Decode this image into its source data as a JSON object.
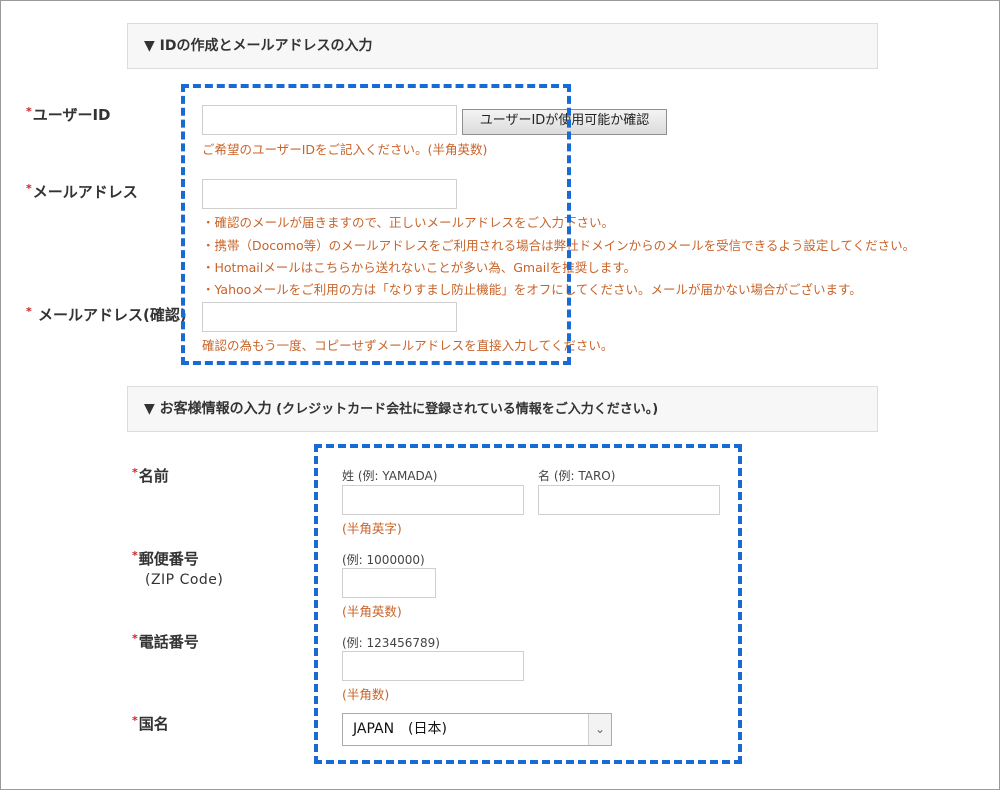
{
  "section1": {
    "title": "▼ IDの作成とメールアドレスの入力"
  },
  "user_id": {
    "required_mark": "*",
    "label": "ユーザーID",
    "check_button": "ユーザーIDが使用可能か確認",
    "hint": "ご希望のユーザーIDをご記入ください。(半角英数)"
  },
  "email": {
    "required_mark": "*",
    "label": "メールアドレス",
    "notes": [
      "・確認のメールが届きますので、正しいメールアドレスをご入力下さい。",
      "・携帯（Docomo等）のメールアドレスをご利用される場合は弊社ドメインからのメールを受信できるよう設定してください。",
      "・Hotmailメールはこちらから送れないことが多い為、Gmailを推奨します。",
      "・Yahooメールをご利用の方は「なりすまし防止機能」をオフにしてください。メールが届かない場合がございます。"
    ]
  },
  "email_confirm": {
    "required_mark": "*",
    "label": " メールアドレス(確認)",
    "hint": "確認の為もう一度、コピーせずメールアドレスを直接入力してください。"
  },
  "section2": {
    "title": "▼ お客様情報の入力",
    "subtitle": " (クレジットカード会社に登録されている情報をご入力ください。)"
  },
  "name": {
    "required_mark": "*",
    "label": "名前",
    "last_caption": "姓 (例: YAMADA)",
    "first_caption": "名 (例: TARO)",
    "hint": "(半角英字)"
  },
  "zip": {
    "required_mark": "*",
    "label": "郵便番号",
    "sublabel": "(ZIP Code)",
    "caption": "(例: 1000000)",
    "hint": "(半角英数)"
  },
  "phone": {
    "required_mark": "*",
    "label": "電話番号",
    "caption": "(例: 123456789)",
    "hint": "(半角数)"
  },
  "country": {
    "required_mark": "*",
    "label": "国名",
    "selected": "JAPAN　(日本)",
    "arrow": "⌄"
  },
  "colors": {
    "accent_dashed": "#1a6ad6",
    "note_text": "#c8642a",
    "required_mark": "#cc2222"
  }
}
